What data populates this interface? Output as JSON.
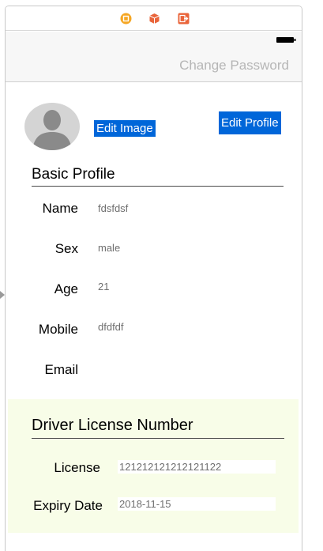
{
  "scene_dock": {
    "icons": [
      "view-controller-icon",
      "first-responder-icon",
      "exit-icon"
    ],
    "colors": {
      "view_controller": "#f5a623",
      "cube": "#e9643a",
      "exit": "#e9643a"
    }
  },
  "navbar": {
    "right_item": "Change Password"
  },
  "profile": {
    "edit_image_label": "Edit Image",
    "edit_profile_label": "Edit Profile"
  },
  "basic_profile": {
    "title": "Basic Profile",
    "fields": [
      {
        "label": "Name",
        "value": "fdsfdsf"
      },
      {
        "label": "Sex",
        "value": "male"
      },
      {
        "label": "Age",
        "value": "21"
      },
      {
        "label": "Mobile",
        "value": "dfdfdf"
      },
      {
        "label": "Email",
        "value": ""
      }
    ]
  },
  "driver_license": {
    "title": "Driver License Number",
    "license_label": "License",
    "license_value": "121212121212121122",
    "expiry_label": "Expiry Date",
    "expiry_value": "2018-11-15"
  },
  "colors": {
    "accent": "#0066d9",
    "panel_bg": "#f8fde8"
  }
}
